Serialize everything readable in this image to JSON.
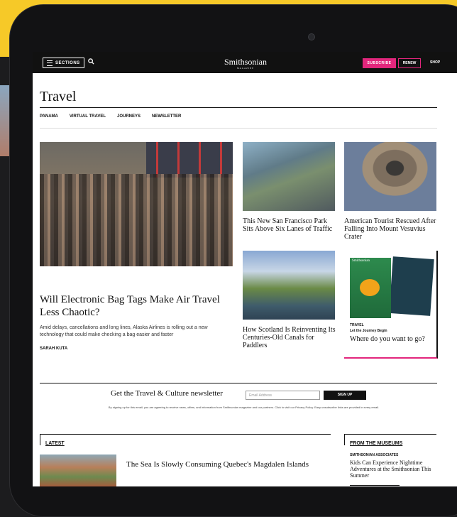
{
  "header": {
    "sections_label": "SECTIONS",
    "logo": "Smithsonian",
    "logo_sub": "MAGAZINE",
    "subscribe_label": "SUBSCRIBE",
    "renew_label": "RENEW",
    "shop_label": "SHOP"
  },
  "page": {
    "title": "Travel"
  },
  "subnav": {
    "items": [
      "PANAMA",
      "VIRTUAL TRAVEL",
      "JOURNEYS",
      "NEWSLETTER"
    ]
  },
  "hero": {
    "title": "Will Electronic Bag Tags Make Air Travel Less Chaotic?",
    "description": "Amid delays, cancellations and long lines, Alaska Airlines is rolling out a new technology that could make checking a bag easier and faster",
    "author": "SARAH KUTA"
  },
  "cards": [
    {
      "title": "This New San Francisco Park Sits Above Six Lanes of Traffic"
    },
    {
      "title": "American Tourist Rescued After Falling Into Mount Vesuvius Crater"
    },
    {
      "title": "How Scotland Is Reinventing Its Centuries-Old Canals for Paddlers"
    }
  ],
  "ad": {
    "magazine_label": "Smithsonian",
    "category": "TRAVEL",
    "tagline": "Let the Journey Begin",
    "title": "Where do you want to go?"
  },
  "newsletter": {
    "label": "Get the Travel & Culture newsletter",
    "email_placeholder": "Email Address",
    "signup_label": "SIGN UP",
    "legal": "By signing up for this email, you are agreeing to receive news, offers, and information from Smithsonian magazine and our partners. Click to visit our Privacy Policy. Easy unsubscribe links are provided in every email."
  },
  "latest": {
    "label": "LATEST",
    "title": "The Sea Is Slowly Consuming Quebec's Magdalen Islands"
  },
  "from_museums": {
    "label": "FROM THE MUSEUMS",
    "tag": "SMITHSONIAN ASSOCIATES",
    "title": "Kids Can Experience Nighttime Adventures at the Smithsonian This Summer"
  }
}
